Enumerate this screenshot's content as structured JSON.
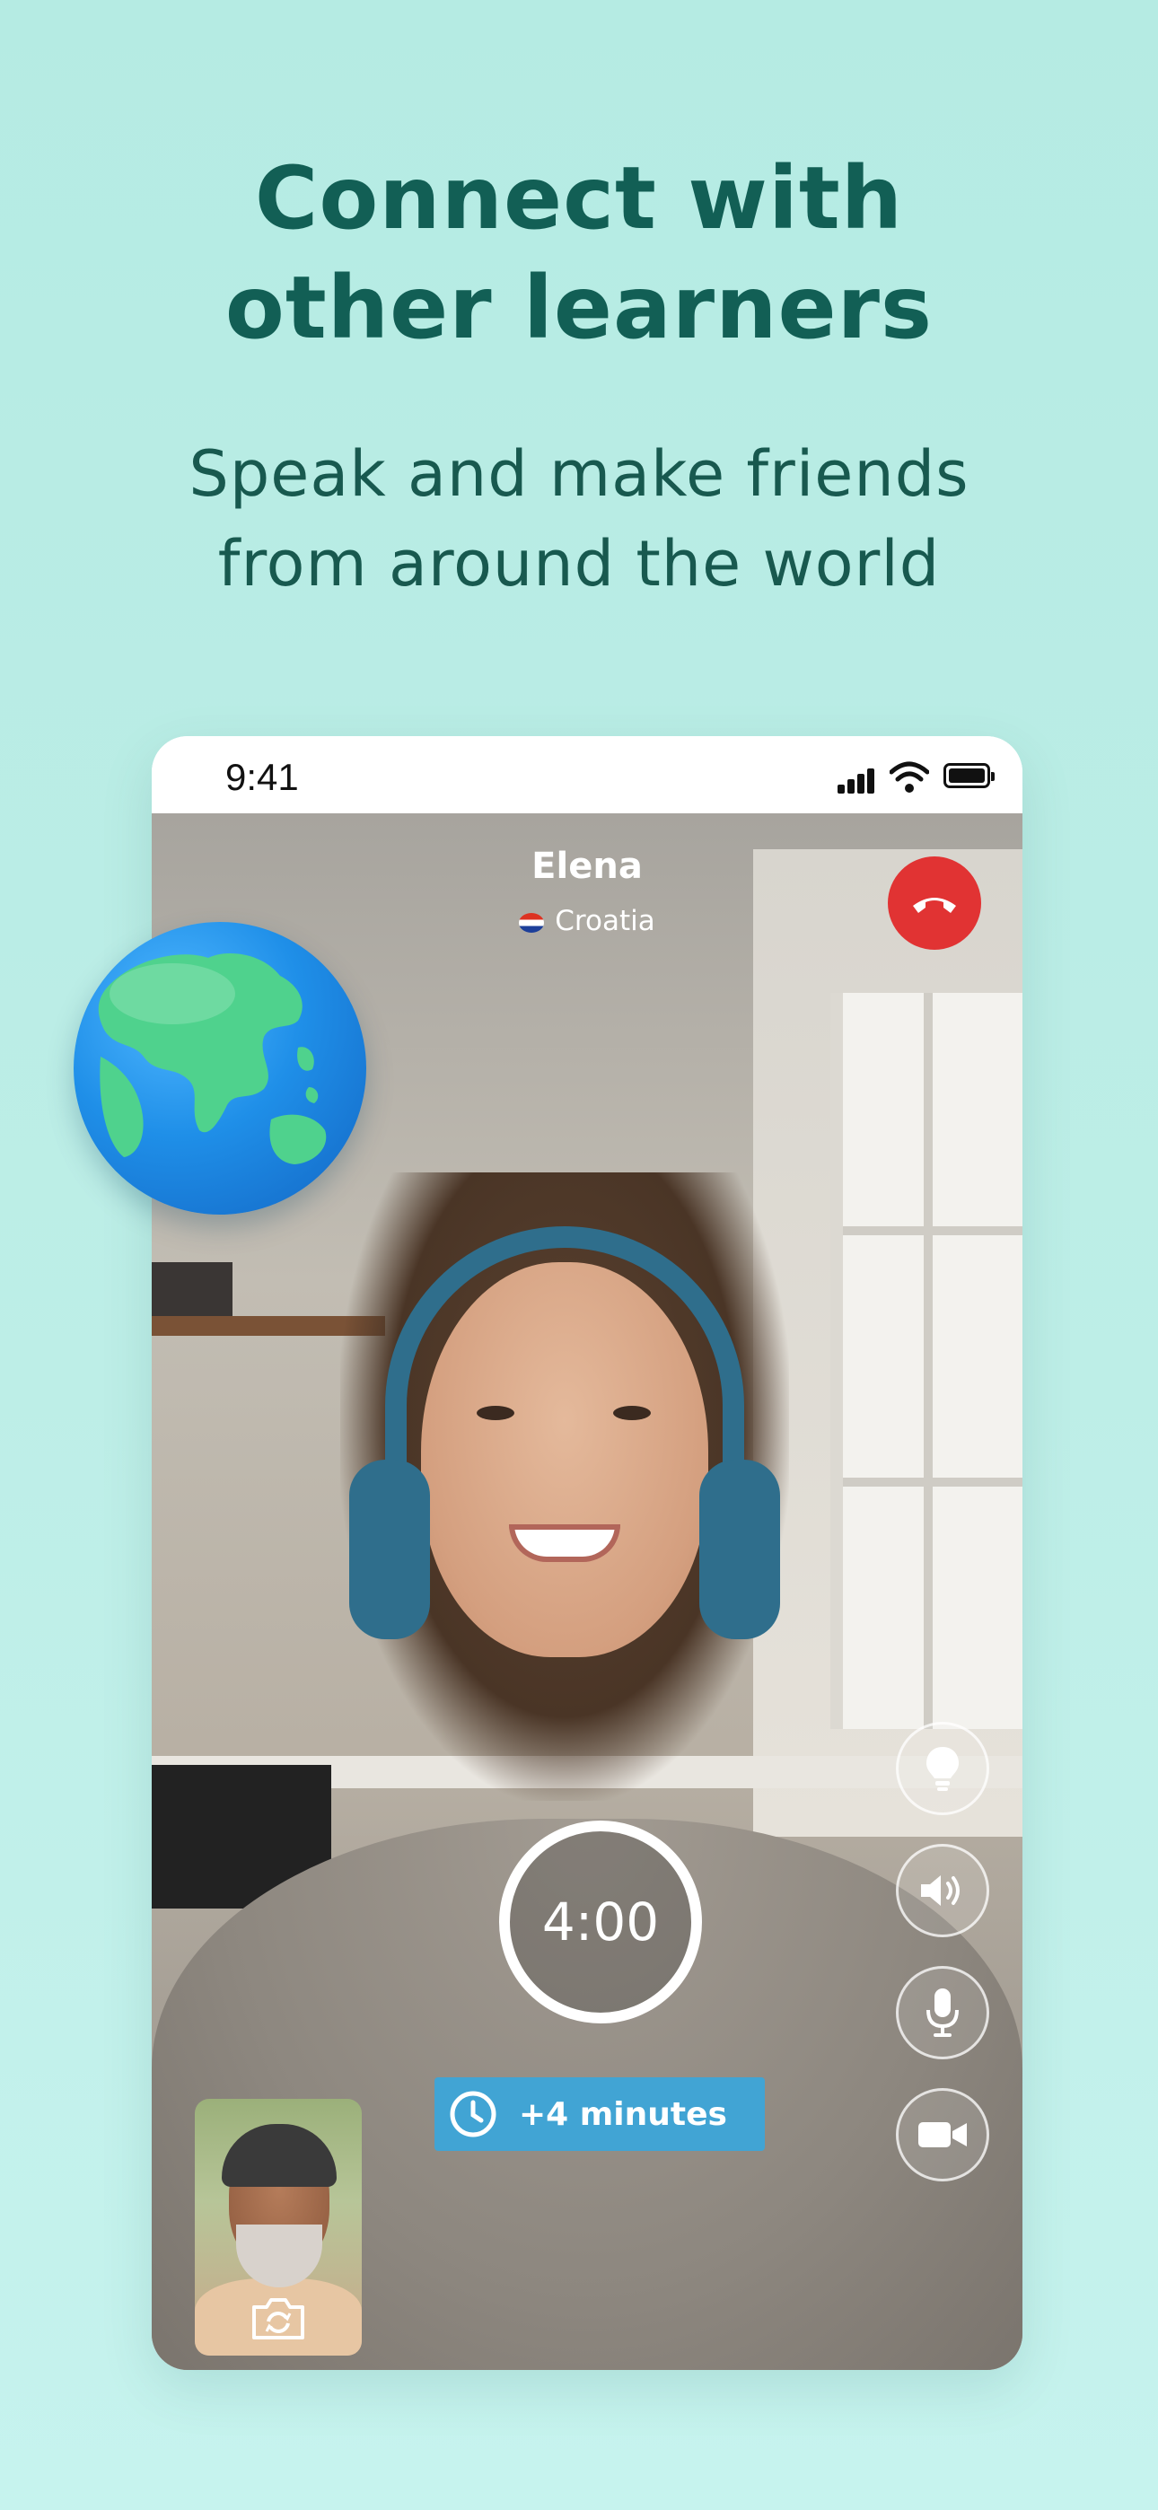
{
  "headline": {
    "line1": "Connect with",
    "line2": "other learners"
  },
  "subheadline": {
    "line1": "Speak and make friends",
    "line2": "from around the world"
  },
  "status_bar": {
    "time": "9:41"
  },
  "call": {
    "partner_name": "Elena",
    "partner_country": "Croatia",
    "timer": "4:00",
    "extend_label": "+4 minutes"
  },
  "controls": {
    "side_buttons": [
      "lightbulb-icon",
      "speaker-icon",
      "microphone-icon",
      "video-camera-icon"
    ],
    "hangup": "phone-hangup-icon",
    "camera_switch": "camera-switch-icon"
  },
  "colors": {
    "background": "#b5ebe3",
    "headline": "#125f55",
    "hangup": "#e13333",
    "extend_button": "#41a4d4"
  }
}
